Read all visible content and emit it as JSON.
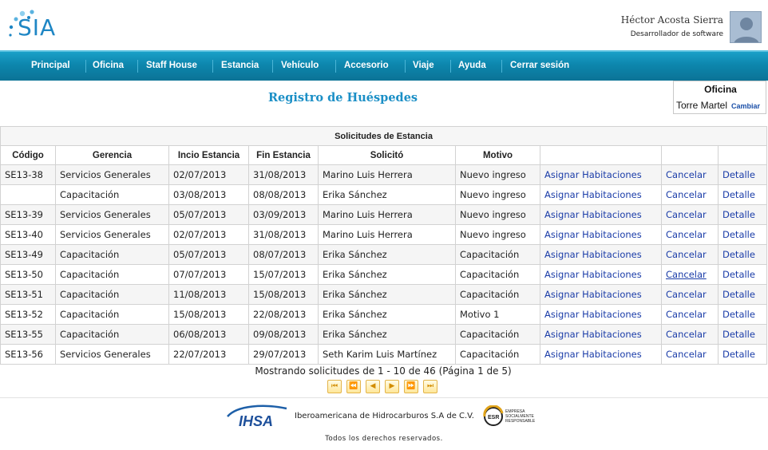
{
  "app": {
    "logo_text": "SIA"
  },
  "user": {
    "name": "Héctor Acosta Sierra",
    "role": "Desarrollador de software"
  },
  "nav": {
    "items": [
      "Principal",
      "Oficina",
      "Staff House",
      "Estancia",
      "Vehículo",
      "Accesorio",
      "Viaje",
      "Ayuda",
      "Cerrar sesión"
    ]
  },
  "page": {
    "title": "Registro de Huéspedes"
  },
  "office": {
    "title": "Oficina",
    "value": "Torre Martel",
    "change_label": "Cambiar"
  },
  "table": {
    "caption": "Solicitudes de Estancia",
    "headers": [
      "Código",
      "Gerencia",
      "Incio Estancia",
      "Fin Estancia",
      "Solicitó",
      "Motivo",
      "",
      "",
      ""
    ],
    "rows": [
      [
        "SE13-38",
        "Servicios Generales",
        "02/07/2013",
        "31/08/2013",
        "Marino Luis Herrera",
        "Nuevo ingreso",
        "Asignar Habitaciones",
        "Cancelar",
        "Detalle"
      ],
      [
        "",
        "Capacitación",
        "03/08/2013",
        "08/08/2013",
        "Erika Sánchez",
        "Nuevo ingreso",
        "Asignar Habitaciones",
        "Cancelar",
        "Detalle"
      ],
      [
        "SE13-39",
        "Servicios Generales",
        "05/07/2013",
        "03/09/2013",
        "Marino Luis Herrera",
        "Nuevo ingreso",
        "Asignar Habitaciones",
        "Cancelar",
        "Detalle"
      ],
      [
        "SE13-40",
        "Servicios Generales",
        "02/07/2013",
        "31/08/2013",
        "Marino Luis Herrera",
        "Nuevo ingreso",
        "Asignar Habitaciones",
        "Cancelar",
        "Detalle"
      ],
      [
        "SE13-49",
        "Capacitación",
        "05/07/2013",
        "08/07/2013",
        "Erika Sánchez",
        "Capacitación",
        "Asignar Habitaciones",
        "Cancelar",
        "Detalle"
      ],
      [
        "SE13-50",
        "Capacitación",
        "07/07/2013",
        "15/07/2013",
        "Erika Sánchez",
        "Capacitación",
        "Asignar Habitaciones",
        "Cancelar",
        "Detalle"
      ],
      [
        "SE13-51",
        "Capacitación",
        "11/08/2013",
        "15/08/2013",
        "Erika Sánchez",
        "Capacitación",
        "Asignar Habitaciones",
        "Cancelar",
        "Detalle"
      ],
      [
        "SE13-52",
        "Capacitación",
        "15/08/2013",
        "22/08/2013",
        "Erika Sánchez",
        "Motivo 1",
        "Asignar Habitaciones",
        "Cancelar",
        "Detalle"
      ],
      [
        "SE13-55",
        "Capacitación",
        "06/08/2013",
        "09/08/2013",
        "Erika Sánchez",
        "Capacitación",
        "Asignar Habitaciones",
        "Cancelar",
        "Detalle"
      ],
      [
        "SE13-56",
        "Servicios Generales",
        "22/07/2013",
        "29/07/2013",
        "Seth Karim Luis Martínez",
        "Capacitación",
        "Asignar Habitaciones",
        "Cancelar",
        "Detalle"
      ]
    ],
    "hovered_cancel_row": 5
  },
  "pager": {
    "status": "Mostrando solicitudes de 1 - 10 de 46 (Página 1 de 5)",
    "buttons": [
      {
        "icon": "first-page-icon",
        "glyph": "⏮"
      },
      {
        "icon": "rewind-icon",
        "glyph": "⏪"
      },
      {
        "icon": "previous-icon",
        "glyph": "◀"
      },
      {
        "icon": "next-icon",
        "glyph": "▶"
      },
      {
        "icon": "fast-forward-icon",
        "glyph": "⏩"
      },
      {
        "icon": "last-page-icon",
        "glyph": "⏭"
      }
    ]
  },
  "footer": {
    "logo_text": "IHSA",
    "company": "Iberoamericana de Hidrocarburos S.A de C.V.",
    "esr_text": "ESR",
    "esr_caption": [
      "EMPRESA",
      "SOCIALMENTE",
      "RESPONSABLE"
    ],
    "rights": "Todos los derechos reservados."
  },
  "colors": {
    "nav_bg": "#0d86ad",
    "title": "#1b8fc6",
    "link": "#1a3ca8"
  }
}
